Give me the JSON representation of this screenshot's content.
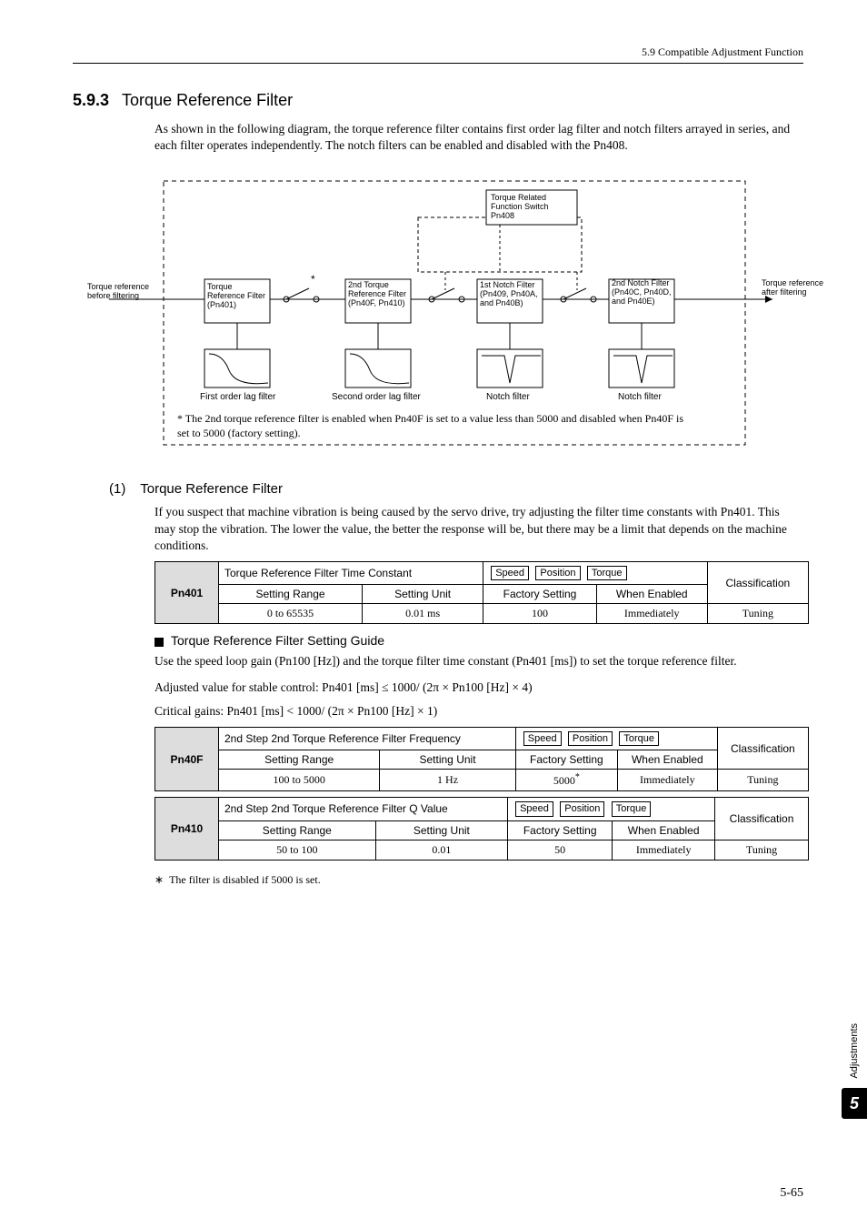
{
  "header": {
    "breadcrumb": "5.9  Compatible Adjustment Function"
  },
  "section": {
    "number": "5.9.3",
    "title": "Torque Reference Filter",
    "intro": "As shown in the following diagram, the torque reference filter contains first order lag filter and notch filters arrayed in series, and each filter operates independently. The notch filters can be enabled and disabled with the Pn408."
  },
  "diagram": {
    "in_label": "Torque reference before filtering",
    "out_label": "Torque reference after filtering",
    "switch_box": "Torque Related Function Switch Pn408",
    "asterisk": "*",
    "b1": "Torque Reference Filter (Pn401)",
    "b2": "2nd Torque Reference Filter (Pn40F, Pn410)",
    "b3": "1st Notch Filter (Pn409, Pn40A, and Pn40B)",
    "b4": "2nd Notch Filter (Pn40C, Pn40D, and Pn40E)",
    "cap1": "First order lag filter",
    "cap2": "Second order lag filter",
    "cap3": "Notch filter",
    "cap4": "Notch filter",
    "footnote": "* The 2nd torque reference filter is enabled when Pn40F is set to a value less than 5000 and disabled when Pn40F is set to 5000 (factory setting)."
  },
  "sub1": {
    "num": "(1)",
    "title": "Torque Reference Filter",
    "p1": "If you suspect that machine vibration is being caused by the servo drive, try adjusting the filter time constants with Pn401. This may stop the vibration. The lower the value, the better the response will be, but there may be a limit that depends on the machine conditions."
  },
  "table1": {
    "pn": "Pn401",
    "title": "Torque Reference Filter Time Constant",
    "tags": [
      "Speed",
      "Position",
      "Torque"
    ],
    "class_label": "Classification",
    "h": [
      "Setting Range",
      "Setting Unit",
      "Factory Setting",
      "When Enabled"
    ],
    "r": [
      "0 to 65535",
      "0.01 ms",
      "100",
      "Immediately",
      "Tuning"
    ]
  },
  "guide": {
    "title": "Torque Reference Filter Setting Guide",
    "p1": "Use the speed loop gain (Pn100 [Hz]) and the torque filter time constant (Pn401 [ms]) to set the torque reference filter.",
    "p2": "Adjusted value for stable control: Pn401 [ms] ≤ 1000/ (2π × Pn100 [Hz] × 4)",
    "p3": "Critical gains: Pn401 [ms] < 1000/ (2π × Pn100 [Hz] × 1)"
  },
  "table2": {
    "pn": "Pn40F",
    "title": "2nd Step 2nd Torque Reference Filter Frequency",
    "tags": [
      "Speed",
      "Position",
      "Torque"
    ],
    "class_label": "Classification",
    "h": [
      "Setting Range",
      "Setting Unit",
      "Factory Setting",
      "When Enabled"
    ],
    "r": [
      "100 to 5000",
      "1 Hz",
      "5000",
      "Immediately",
      "Tuning"
    ],
    "fs_sup": "*"
  },
  "table3": {
    "pn": "Pn410",
    "title": "2nd Step 2nd Torque Reference Filter Q Value",
    "tags": [
      "Speed",
      "Position",
      "Torque"
    ],
    "class_label": "Classification",
    "h": [
      "Setting Range",
      "Setting Unit",
      "Factory Setting",
      "When Enabled"
    ],
    "r": [
      "50 to 100",
      "0.01",
      "50",
      "Immediately",
      "Tuning"
    ]
  },
  "footnote2": {
    "mark": "∗",
    "text": "The filter is disabled if 5000 is set."
  },
  "side": {
    "label": "Adjustments",
    "chapter": "5"
  },
  "footer": {
    "page": "5-65"
  }
}
